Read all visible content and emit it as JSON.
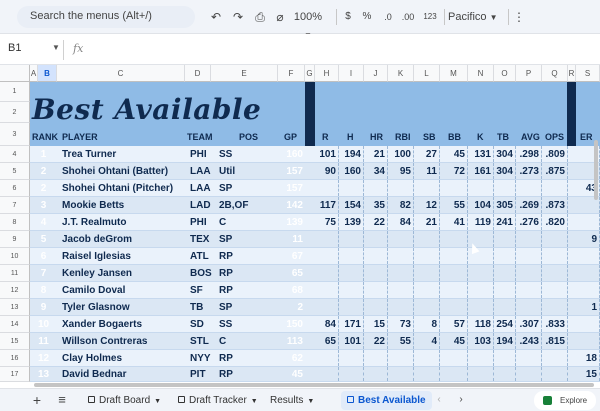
{
  "toolbar": {
    "search_placeholder": "Search the menus (Alt+/)",
    "undo": "↶",
    "redo": "↷",
    "print": "⎙",
    "paint": "⌀",
    "zoom": "100%",
    "currency": "$",
    "percent": "%",
    "decrease_decimal": ".0",
    "increase_decimal": ".00",
    "number_format": "123",
    "font": "Pacifico",
    "more": "⋮"
  },
  "formula_bar": {
    "cell_ref": "B1",
    "fx": "fx",
    "value": ""
  },
  "columns": [
    "A",
    "B",
    "C",
    "D",
    "E",
    "F",
    "G",
    "H",
    "I",
    "J",
    "K",
    "L",
    "M",
    "N",
    "O",
    "P",
    "Q",
    "R",
    "S"
  ],
  "selected_column": "B",
  "row_numbers": [
    "1",
    "2",
    "3",
    "4",
    "5",
    "6",
    "7",
    "8",
    "9",
    "10",
    "11",
    "12",
    "13",
    "14",
    "15",
    "16",
    "17"
  ],
  "sheet": {
    "title": "Best Available",
    "headers": {
      "rank": "RANK",
      "player": "PLAYER",
      "team": "TEAM",
      "pos": "POS",
      "gp": "GP",
      "r": "R",
      "h": "H",
      "hr": "HR",
      "rbi": "RBI",
      "sb": "SB",
      "bb": "BB",
      "k": "K",
      "tb": "TB",
      "avg": "AVG",
      "ops": "OPS",
      "er": "ER"
    },
    "players": [
      {
        "rank": "1",
        "player": "Trea Turner",
        "team": "PHI",
        "pos": "SS",
        "gp": "160",
        "r": "101",
        "h": "194",
        "hr": "21",
        "rbi": "100",
        "sb": "27",
        "bb": "45",
        "k": "131",
        "tb": "304",
        "avg": ".298",
        "ops": ".809",
        "er": ""
      },
      {
        "rank": "2",
        "player": "Shohei Ohtani (Batter)",
        "team": "LAA",
        "pos": "Util",
        "gp": "157",
        "r": "90",
        "h": "160",
        "hr": "34",
        "rbi": "95",
        "sb": "11",
        "bb": "72",
        "k": "161",
        "tb": "304",
        "avg": ".273",
        "ops": ".875",
        "er": ""
      },
      {
        "rank": "2",
        "player": "Shohei Ohtani (Pitcher)",
        "team": "LAA",
        "pos": "SP",
        "gp": "157",
        "r": "",
        "h": "",
        "hr": "",
        "rbi": "",
        "sb": "",
        "bb": "",
        "k": "",
        "tb": "",
        "avg": "",
        "ops": "",
        "er": "43"
      },
      {
        "rank": "3",
        "player": "Mookie Betts",
        "team": "LAD",
        "pos": "2B,OF",
        "gp": "142",
        "r": "117",
        "h": "154",
        "hr": "35",
        "rbi": "82",
        "sb": "12",
        "bb": "55",
        "k": "104",
        "tb": "305",
        "avg": ".269",
        "ops": ".873",
        "er": ""
      },
      {
        "rank": "4",
        "player": "J.T. Realmuto",
        "team": "PHI",
        "pos": "C",
        "gp": "139",
        "r": "75",
        "h": "139",
        "hr": "22",
        "rbi": "84",
        "sb": "21",
        "bb": "41",
        "k": "119",
        "tb": "241",
        "avg": ".276",
        "ops": ".820",
        "er": ""
      },
      {
        "rank": "5",
        "player": "Jacob deGrom",
        "team": "TEX",
        "pos": "SP",
        "gp": "11",
        "r": "",
        "h": "",
        "hr": "",
        "rbi": "",
        "sb": "",
        "bb": "",
        "k": "",
        "tb": "",
        "avg": "",
        "ops": "",
        "er": "9"
      },
      {
        "rank": "6",
        "player": "Raisel Iglesias",
        "team": "ATL",
        "pos": "RP",
        "gp": "67",
        "r": "",
        "h": "",
        "hr": "",
        "rbi": "",
        "sb": "",
        "bb": "",
        "k": "",
        "tb": "",
        "avg": "",
        "ops": "",
        "er": ""
      },
      {
        "rank": "7",
        "player": "Kenley Jansen",
        "team": "BOS",
        "pos": "RP",
        "gp": "65",
        "r": "",
        "h": "",
        "hr": "",
        "rbi": "",
        "sb": "",
        "bb": "",
        "k": "",
        "tb": "",
        "avg": "",
        "ops": "",
        "er": ""
      },
      {
        "rank": "8",
        "player": "Camilo Doval",
        "team": "SF",
        "pos": "RP",
        "gp": "68",
        "r": "",
        "h": "",
        "hr": "",
        "rbi": "",
        "sb": "",
        "bb": "",
        "k": "",
        "tb": "",
        "avg": "",
        "ops": "",
        "er": ""
      },
      {
        "rank": "9",
        "player": "Tyler Glasnow",
        "team": "TB",
        "pos": "SP",
        "gp": "2",
        "r": "",
        "h": "",
        "hr": "",
        "rbi": "",
        "sb": "",
        "bb": "",
        "k": "",
        "tb": "",
        "avg": "",
        "ops": "",
        "er": "1"
      },
      {
        "rank": "10",
        "player": "Xander Bogaerts",
        "team": "SD",
        "pos": "SS",
        "gp": "150",
        "r": "84",
        "h": "171",
        "hr": "15",
        "rbi": "73",
        "sb": "8",
        "bb": "57",
        "k": "118",
        "tb": "254",
        "avg": ".307",
        "ops": ".833",
        "er": ""
      },
      {
        "rank": "11",
        "player": "Willson Contreras",
        "team": "STL",
        "pos": "C",
        "gp": "113",
        "r": "65",
        "h": "101",
        "hr": "22",
        "rbi": "55",
        "sb": "4",
        "bb": "45",
        "k": "103",
        "tb": "194",
        "avg": ".243",
        "ops": ".815",
        "er": ""
      },
      {
        "rank": "12",
        "player": "Clay Holmes",
        "team": "NYY",
        "pos": "RP",
        "gp": "62",
        "r": "",
        "h": "",
        "hr": "",
        "rbi": "",
        "sb": "",
        "bb": "",
        "k": "",
        "tb": "",
        "avg": "",
        "ops": "",
        "er": "18"
      },
      {
        "rank": "13",
        "player": "David Bednar",
        "team": "PIT",
        "pos": "RP",
        "gp": "45",
        "r": "",
        "h": "",
        "hr": "",
        "rbi": "",
        "sb": "",
        "bb": "",
        "k": "",
        "tb": "",
        "avg": "",
        "ops": "",
        "er": "15"
      }
    ]
  },
  "tabs": [
    {
      "label": "Draft Board",
      "locked": true,
      "active": false
    },
    {
      "label": "Draft Tracker",
      "locked": true,
      "active": false
    },
    {
      "label": "Results",
      "locked": false,
      "active": false
    },
    {
      "label": "Best Available",
      "locked": true,
      "active": true
    }
  ],
  "bottom": {
    "add": "+",
    "all_sheets": "≡",
    "explore": "Explore"
  },
  "colors": {
    "navy": "#0f2a4f",
    "panel_blue": "#5b9bd5",
    "light_band": "#dbe7f4",
    "title_bg": "#8fbbe6"
  }
}
